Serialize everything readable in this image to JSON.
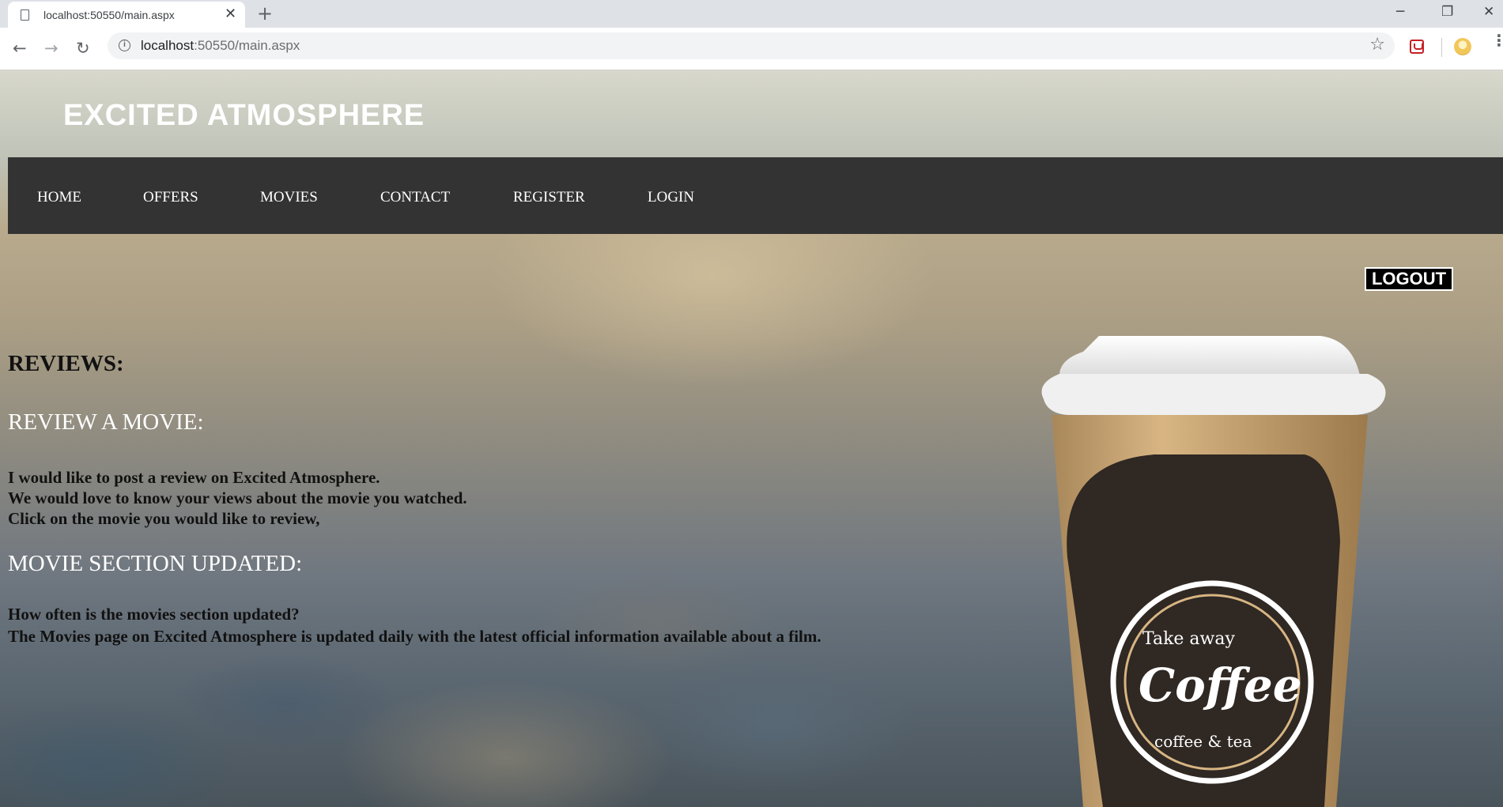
{
  "browser": {
    "tab_title": "localhost:50550/main.aspx",
    "url_host": "localhost",
    "url_rest": ":50550/main.aspx"
  },
  "site": {
    "title": "EXCITED ATMOSPHERE",
    "nav": [
      "HOME",
      "OFFERS",
      "MOVIES",
      "CONTACT",
      "REGISTER",
      "LOGIN"
    ],
    "logout_label": "LOGOUT"
  },
  "content": {
    "reviews_heading": "REVIEWS:",
    "review_heading": "REVIEW A MOVIE:",
    "review_lines": [
      "I would like to post a review on Excited Atmosphere.",
      "We would love to know your views about the movie you watched.",
      "Click on the movie you would like to review,"
    ],
    "movie_heading": "MOVIE SECTION UPDATED:",
    "movie_lines": [
      "How often is the movies section updated?",
      "The Movies page on Excited Atmosphere is updated daily with the latest official information available about a film."
    ]
  },
  "cup_logo": {
    "top_text": "Take away",
    "main_text": "Coffee",
    "bottom_text": "coffee & tea"
  }
}
